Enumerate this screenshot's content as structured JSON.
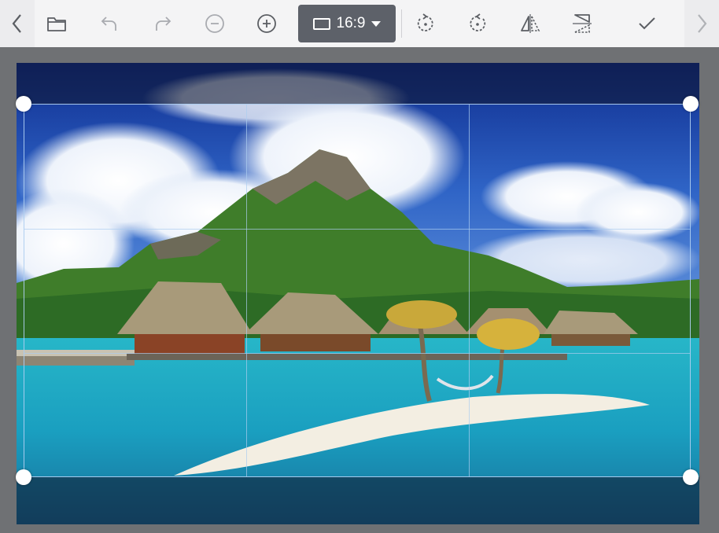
{
  "toolbar": {
    "back": {
      "icon": "chevron-left-icon"
    },
    "open": {
      "icon": "folder-icon"
    },
    "undo": {
      "icon": "undo-icon"
    },
    "redo": {
      "icon": "redo-icon"
    },
    "zoom_out": {
      "icon": "zoom-out-icon"
    },
    "zoom_in": {
      "icon": "zoom-in-icon"
    },
    "aspect_ratio": {
      "label": "16:9",
      "icon": "aspect-rectangle-icon"
    },
    "rotate_left": {
      "icon": "rotate-left-icon"
    },
    "rotate_right": {
      "icon": "rotate-right-icon"
    },
    "flip_horizontal": {
      "icon": "flip-horizontal-icon"
    },
    "flip_vertical": {
      "icon": "flip-vertical-icon"
    },
    "apply": {
      "icon": "checkmark-icon"
    },
    "forward": {
      "icon": "chevron-right-icon"
    }
  },
  "colors": {
    "toolbar_bg": "#f4f4f5",
    "ratio_button_bg": "#5d6169",
    "workspace_bg": "#6f7174",
    "crop_border": "#adcdf0",
    "icon": "#5b5e63"
  }
}
